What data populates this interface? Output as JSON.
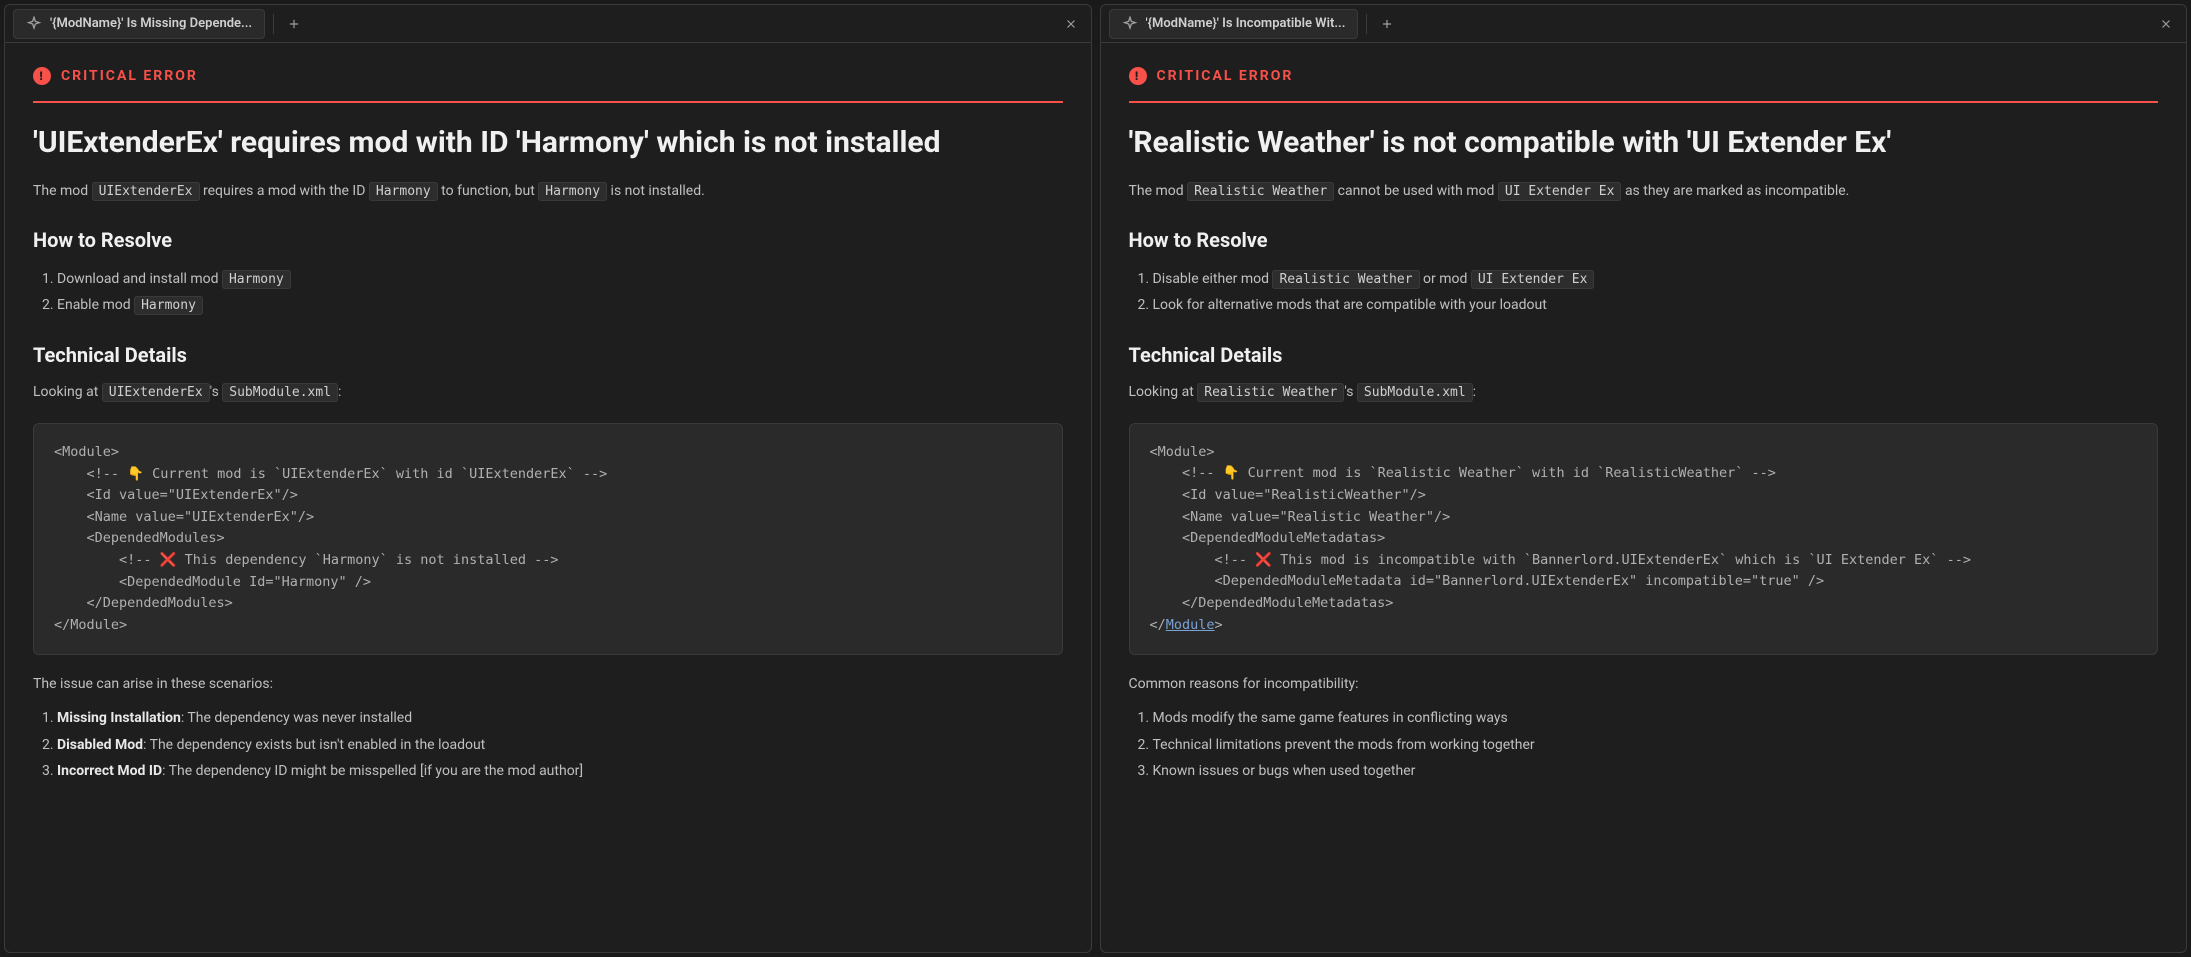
{
  "panes": [
    {
      "tab_title": "'{ModName}' Is Missing Depende...",
      "badge": "CRITICAL ERROR",
      "heading": "'UIExtenderEx' requires mod with ID 'Harmony' which is not installed",
      "summary_pre": "The mod ",
      "summary_code1": "UIExtenderEx",
      "summary_mid1": " requires a mod with the ID ",
      "summary_code2": "Harmony",
      "summary_mid2": " to function, but ",
      "summary_code3": "Harmony",
      "summary_post": " is not installed.",
      "resolve_heading": "How to Resolve",
      "resolve_item1_pre": "Download and install mod ",
      "resolve_item1_code": "Harmony",
      "resolve_item2_pre": "Enable mod ",
      "resolve_item2_code": "Harmony",
      "tech_heading": "Technical Details",
      "tech_look_pre": "Looking at ",
      "tech_look_code1": "UIExtenderEx",
      "tech_look_mid": "'s ",
      "tech_look_code2": "SubModule.xml",
      "tech_look_post": ":",
      "code_block": "<Module>\n    <!-- 👇 Current mod is `UIExtenderEx` with id `UIExtenderEx` -->\n    <Id value=\"UIExtenderEx\"/>\n    <Name value=\"UIExtenderEx\"/>\n    <DependedModules>\n        <!-- ❌ This dependency `Harmony` is not installed -->\n        <DependedModule Id=\"Harmony\" />\n    </DependedModules>\n</Module>",
      "scenario_intro": "The issue can arise in these scenarios:",
      "scenario1_strong": "Missing Installation",
      "scenario1_rest": ": The dependency was never installed",
      "scenario2_strong": "Disabled Mod",
      "scenario2_rest": ": The dependency exists but isn't enabled in the loadout",
      "scenario3_strong": "Incorrect Mod ID",
      "scenario3_rest": ": The dependency ID might be misspelled [if you are the mod author]"
    },
    {
      "tab_title": "'{ModName}' Is Incompatible Wit...",
      "badge": "CRITICAL ERROR",
      "heading": "'Realistic Weather' is not compatible with 'UI Extender Ex'",
      "summary_pre": "The mod ",
      "summary_code1": "Realistic Weather",
      "summary_mid1": " cannot be used with mod ",
      "summary_code2": "UI Extender Ex",
      "summary_post": " as they are marked as incompatible.",
      "resolve_heading": "How to Resolve",
      "resolve_item1_pre": "Disable either mod ",
      "resolve_item1_code": "Realistic Weather",
      "resolve_item1_mid": " or mod ",
      "resolve_item1_code2": "UI Extender Ex",
      "resolve_item2_text": "Look for alternative mods that are compatible with your loadout",
      "tech_heading": "Technical Details",
      "tech_look_pre": "Looking at ",
      "tech_look_code1": "Realistic Weather",
      "tech_look_mid": "'s ",
      "tech_look_code2": "SubModule.xml",
      "tech_look_post": ":",
      "code_block": "<Module>\n    <!-- 👇 Current mod is `Realistic Weather` with id `RealisticWeather` -->\n    <Id value=\"RealisticWeather\"/>\n    <Name value=\"Realistic Weather\"/>\n    <DependedModuleMetadatas>\n        <!-- ❌ This mod is incompatible with `Bannerlord.UIExtenderEx` which is `UI Extender Ex` -->\n        <DependedModuleMetadata id=\"Bannerlord.UIExtenderEx\" incompatible=\"true\" />\n    </DependedModuleMetadatas>\n</",
      "code_link": "Module",
      "code_after_link": ">",
      "reasons_intro": "Common reasons for incompatibility:",
      "reason1": "Mods modify the same game features in conflicting ways",
      "reason2": "Technical limitations prevent the mods from working together",
      "reason3": "Known issues or bugs when used together"
    }
  ]
}
